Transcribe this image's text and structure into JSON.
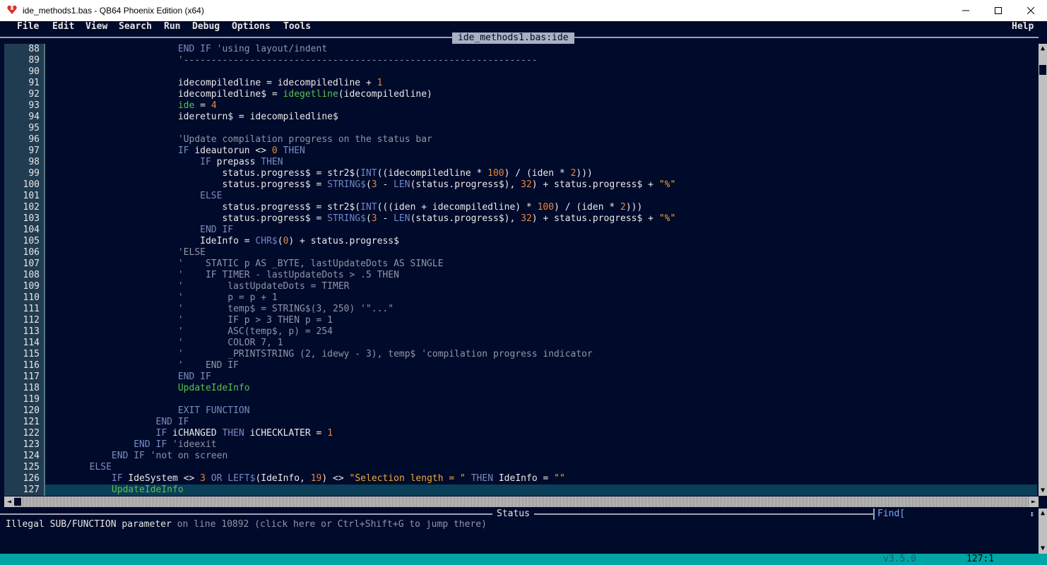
{
  "window": {
    "title": "ide_methods1.bas - QB64 Phoenix Edition (x64)"
  },
  "menu": {
    "items": [
      "File",
      "Edit",
      "View",
      "Search",
      "Run",
      "Debug",
      "Options",
      "Tools"
    ],
    "help": "Help"
  },
  "editor": {
    "tab_title": "ide_methods1.bas:ide",
    "current_line": 127,
    "lines": [
      {
        "n": "88",
        "tokens": [
          [
            "kw",
            "                        END IF"
          ],
          [
            "cmt",
            " 'using layout/indent"
          ]
        ]
      },
      {
        "n": "89",
        "tokens": [
          [
            "cmt",
            "                        '----------------------------------------------------------------"
          ]
        ]
      },
      {
        "n": "90",
        "tokens": []
      },
      {
        "n": "91",
        "tokens": [
          [
            "id",
            "                        idecompiledline = idecompiledline + "
          ],
          [
            "num",
            "1"
          ]
        ]
      },
      {
        "n": "92",
        "tokens": [
          [
            "id",
            "                        idecompiledline$ = "
          ],
          [
            "fn",
            "idegetline"
          ],
          [
            "id",
            "(idecompiledline)"
          ]
        ]
      },
      {
        "n": "93",
        "tokens": [
          [
            "fn",
            "                        ide"
          ],
          [
            "id",
            " = "
          ],
          [
            "num",
            "4"
          ]
        ]
      },
      {
        "n": "94",
        "tokens": [
          [
            "id",
            "                        idereturn$ = idecompiledline$"
          ]
        ]
      },
      {
        "n": "95",
        "tokens": []
      },
      {
        "n": "96",
        "tokens": [
          [
            "cmt",
            "                        'Update compilation progress on the status bar"
          ]
        ]
      },
      {
        "n": "97",
        "tokens": [
          [
            "kw",
            "                        IF"
          ],
          [
            "id",
            " ideautorun <> "
          ],
          [
            "num",
            "0"
          ],
          [
            "kw",
            " THEN"
          ]
        ]
      },
      {
        "n": "98",
        "tokens": [
          [
            "kw",
            "                            IF"
          ],
          [
            "id",
            " prepass "
          ],
          [
            "kw",
            "THEN"
          ]
        ]
      },
      {
        "n": "99",
        "tokens": [
          [
            "id",
            "                                status.progress$ = str2$("
          ],
          [
            "bi",
            "INT"
          ],
          [
            "id",
            "((idecompiledline * "
          ],
          [
            "num",
            "100"
          ],
          [
            "id",
            ") / (iden * "
          ],
          [
            "num",
            "2"
          ],
          [
            "id",
            ")))"
          ]
        ]
      },
      {
        "n": "100",
        "tokens": [
          [
            "id",
            "                                status.progress$ = "
          ],
          [
            "bi",
            "STRING$"
          ],
          [
            "id",
            "("
          ],
          [
            "num",
            "3"
          ],
          [
            "id",
            " - "
          ],
          [
            "bi",
            "LEN"
          ],
          [
            "id",
            "(status.progress$), "
          ],
          [
            "num",
            "32"
          ],
          [
            "id",
            ") + status.progress$ + "
          ],
          [
            "str",
            "\"%\""
          ]
        ]
      },
      {
        "n": "101",
        "tokens": [
          [
            "kw",
            "                            ELSE"
          ]
        ]
      },
      {
        "n": "102",
        "tokens": [
          [
            "id",
            "                                status.progress$ = str2$("
          ],
          [
            "bi",
            "INT"
          ],
          [
            "id",
            "(((iden + idecompiledline) * "
          ],
          [
            "num",
            "100"
          ],
          [
            "id",
            ") / (iden * "
          ],
          [
            "num",
            "2"
          ],
          [
            "id",
            ")))"
          ]
        ]
      },
      {
        "n": "103",
        "tokens": [
          [
            "id",
            "                                status.progress$ = "
          ],
          [
            "bi",
            "STRING$"
          ],
          [
            "id",
            "("
          ],
          [
            "num",
            "3"
          ],
          [
            "id",
            " - "
          ],
          [
            "bi",
            "LEN"
          ],
          [
            "id",
            "(status.progress$), "
          ],
          [
            "num",
            "32"
          ],
          [
            "id",
            ") + status.progress$ + "
          ],
          [
            "str",
            "\"%\""
          ]
        ]
      },
      {
        "n": "104",
        "tokens": [
          [
            "kw",
            "                            END IF"
          ]
        ]
      },
      {
        "n": "105",
        "tokens": [
          [
            "id",
            "                            IdeInfo = "
          ],
          [
            "bi",
            "CHR$"
          ],
          [
            "id",
            "("
          ],
          [
            "num",
            "0"
          ],
          [
            "id",
            ") + status.progress$"
          ]
        ]
      },
      {
        "n": "106",
        "tokens": [
          [
            "cmt",
            "                        'ELSE"
          ]
        ]
      },
      {
        "n": "107",
        "tokens": [
          [
            "cmt",
            "                        '    STATIC p AS _BYTE, lastUpdateDots AS SINGLE"
          ]
        ]
      },
      {
        "n": "108",
        "tokens": [
          [
            "cmt",
            "                        '    IF TIMER - lastUpdateDots > .5 THEN"
          ]
        ]
      },
      {
        "n": "109",
        "tokens": [
          [
            "cmt",
            "                        '        lastUpdateDots = TIMER"
          ]
        ]
      },
      {
        "n": "110",
        "tokens": [
          [
            "cmt",
            "                        '        p = p + 1"
          ]
        ]
      },
      {
        "n": "111",
        "tokens": [
          [
            "cmt",
            "                        '        temp$ = STRING$(3, 250) '\"...\""
          ]
        ]
      },
      {
        "n": "112",
        "tokens": [
          [
            "cmt",
            "                        '        IF p > 3 THEN p = 1"
          ]
        ]
      },
      {
        "n": "113",
        "tokens": [
          [
            "cmt",
            "                        '        ASC(temp$, p) = 254"
          ]
        ]
      },
      {
        "n": "114",
        "tokens": [
          [
            "cmt",
            "                        '        COLOR 7, 1"
          ]
        ]
      },
      {
        "n": "115",
        "tokens": [
          [
            "cmt",
            "                        '        _PRINTSTRING (2, idewy - 3), temp$ 'compilation progress indicator"
          ]
        ]
      },
      {
        "n": "116",
        "tokens": [
          [
            "cmt",
            "                        '    END IF"
          ]
        ]
      },
      {
        "n": "117",
        "tokens": [
          [
            "kw",
            "                        END IF"
          ]
        ]
      },
      {
        "n": "118",
        "tokens": [
          [
            "fn",
            "                        UpdateIdeInfo"
          ]
        ]
      },
      {
        "n": "119",
        "tokens": []
      },
      {
        "n": "120",
        "tokens": [
          [
            "kw",
            "                        EXIT FUNCTION"
          ]
        ]
      },
      {
        "n": "121",
        "tokens": [
          [
            "kw",
            "                    END IF"
          ]
        ]
      },
      {
        "n": "122",
        "tokens": [
          [
            "kw",
            "                    IF"
          ],
          [
            "id",
            " iCHANGED "
          ],
          [
            "kw",
            "THEN"
          ],
          [
            "id",
            " iCHECKLATER = "
          ],
          [
            "num",
            "1"
          ]
        ]
      },
      {
        "n": "123",
        "tokens": [
          [
            "kw",
            "                END IF"
          ],
          [
            "cmt",
            " 'ideexit"
          ]
        ]
      },
      {
        "n": "124",
        "tokens": [
          [
            "kw",
            "            END IF"
          ],
          [
            "cmt",
            " 'not on screen"
          ]
        ]
      },
      {
        "n": "125",
        "tokens": [
          [
            "kw",
            "        ELSE"
          ]
        ]
      },
      {
        "n": "126",
        "tokens": [
          [
            "kw",
            "            IF"
          ],
          [
            "id",
            " IdeSystem <> "
          ],
          [
            "num",
            "3"
          ],
          [
            "kw",
            " OR"
          ],
          [
            "bi",
            " LEFT$"
          ],
          [
            "id",
            "(IdeInfo, "
          ],
          [
            "num",
            "19"
          ],
          [
            "id",
            ") <> "
          ],
          [
            "str",
            "\"Selection length = \""
          ],
          [
            "kw",
            " THEN"
          ],
          [
            "id",
            " IdeInfo = "
          ],
          [
            "str",
            "\"\""
          ]
        ]
      },
      {
        "n": "127",
        "tokens": [
          [
            "fn",
            "            UpdateIdeInfo"
          ]
        ]
      }
    ]
  },
  "status": {
    "header": "Status",
    "message_bold": "Illegal SUB/FUNCTION parameter",
    "message_rest": " on line 10892 (click here or Ctrl+Shift+G to jump there)",
    "find_label": "Find["
  },
  "bottom": {
    "version": "v3.5.0",
    "cursor": "127:1"
  },
  "colors": {
    "background": "#000a2a",
    "line_number_bg": "#213c51",
    "keyword": "#7a8bbf",
    "function": "#58c34a",
    "number": "#e6863a",
    "string": "#f0a83a",
    "comment": "#8f96a8",
    "bottom_bar": "#00a6a6"
  }
}
